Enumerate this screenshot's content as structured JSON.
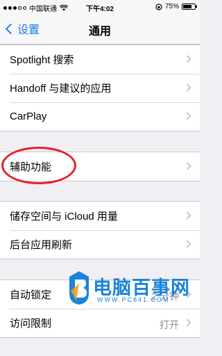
{
  "status_bar": {
    "carrier": "中国联通",
    "time": "下午4:02",
    "battery_percent_text": "75%",
    "battery_level": 0.75
  },
  "nav": {
    "back_label": "设置",
    "title": "通用"
  },
  "groups": [
    {
      "rows": [
        {
          "label": "Spotlight 搜索"
        },
        {
          "label": "Handoff 与建议的应用"
        },
        {
          "label": "CarPlay"
        }
      ]
    },
    {
      "rows": [
        {
          "label": "辅助功能"
        }
      ]
    },
    {
      "rows": [
        {
          "label": "储存空间与 iCloud 用量"
        },
        {
          "label": "后台应用刷新"
        }
      ]
    },
    {
      "rows": [
        {
          "label": "自动锁定",
          "value": "2 分钟"
        },
        {
          "label": "访问限制",
          "value": "打开"
        }
      ]
    }
  ],
  "watermark": {
    "title": "电脑百事网",
    "url": "WWW.PC841.COM"
  },
  "colors": {
    "accent": "#1b7cf5",
    "highlight": "#e6202b",
    "watermark": "#1a84d8"
  }
}
